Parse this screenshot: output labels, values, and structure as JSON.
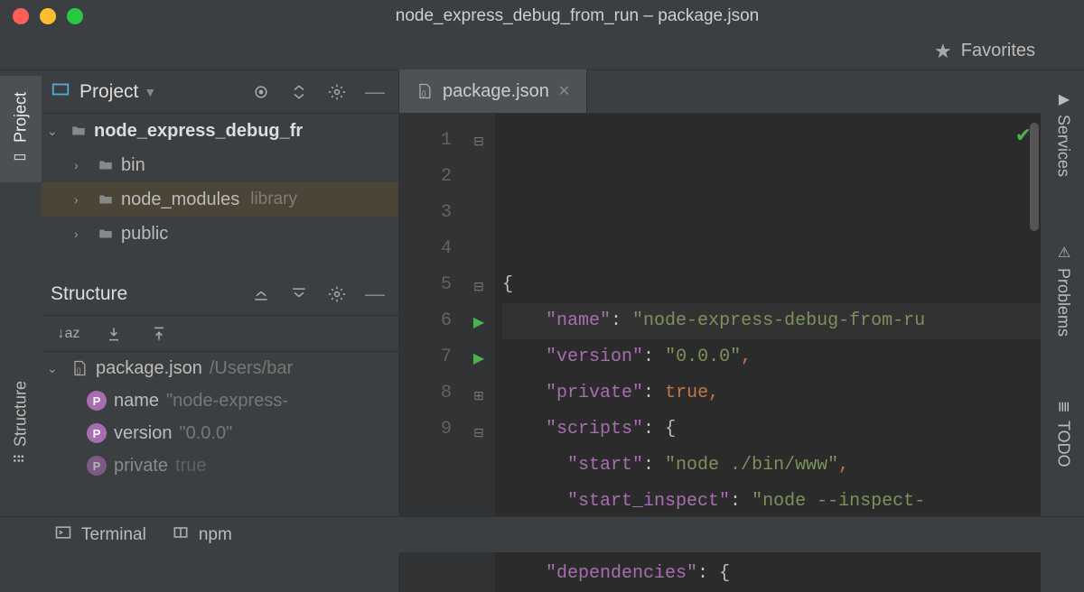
{
  "window": {
    "title": "node_express_debug_from_run – package.json"
  },
  "topbar": {
    "favorites": "Favorites"
  },
  "leftTabs": {
    "project": "Project",
    "structure": "Structure"
  },
  "rightTabs": {
    "services": "Services",
    "problems": "Problems",
    "todo": "TODO"
  },
  "projectPanel": {
    "title": "Project",
    "tree": {
      "root": "node_express_debug_fr",
      "items": [
        {
          "name": "bin",
          "type": "folder"
        },
        {
          "name": "node_modules",
          "type": "folder",
          "badge": "library",
          "selected": true
        },
        {
          "name": "public",
          "type": "folder"
        }
      ]
    }
  },
  "structurePanel": {
    "title": "Structure",
    "root": {
      "file": "package.json",
      "path": "/Users/bar"
    },
    "props": [
      {
        "key": "name",
        "value": "\"node-express-"
      },
      {
        "key": "version",
        "value": "\"0.0.0\""
      },
      {
        "key": "private",
        "value": "true"
      }
    ]
  },
  "editor": {
    "tab": {
      "filename": "package.json"
    },
    "lines": [
      {
        "n": 1,
        "fold": "open",
        "html": "{"
      },
      {
        "n": 2,
        "html": "    \"name\": \"node-express-debug-from-ru",
        "hl": true,
        "key": "name"
      },
      {
        "n": 3,
        "html": "    \"version\": \"0.0.0\",",
        "key": "version"
      },
      {
        "n": 4,
        "html": "    \"private\": true,",
        "key": "private"
      },
      {
        "n": 5,
        "fold": "open",
        "html": "    \"scripts\": {",
        "key": "scripts"
      },
      {
        "n": 6,
        "run": true,
        "html": "      \"start\": \"node ./bin/www\",",
        "key": "start"
      },
      {
        "n": 7,
        "run": true,
        "html": "      \"start_inspect\": \"node --inspect-",
        "key": "start_inspect"
      },
      {
        "n": 8,
        "fold": "close",
        "html": "    },"
      },
      {
        "n": 9,
        "fold": "open",
        "html": "    \"dependencies\": {",
        "key": "dependencies"
      }
    ],
    "code_tokens": [
      [
        {
          "t": "{",
          "c": "pun"
        }
      ],
      [
        {
          "t": "    ",
          "c": ""
        },
        {
          "t": "\"name\"",
          "c": "vkey"
        },
        {
          "t": ": ",
          "c": "pun"
        },
        {
          "t": "\"node-express-debug-from-ru",
          "c": "vstr"
        }
      ],
      [
        {
          "t": "    ",
          "c": ""
        },
        {
          "t": "\"version\"",
          "c": "vkey"
        },
        {
          "t": ": ",
          "c": "pun"
        },
        {
          "t": "\"0.0.0\"",
          "c": "vstr"
        },
        {
          "t": ",",
          "c": "k"
        }
      ],
      [
        {
          "t": "    ",
          "c": ""
        },
        {
          "t": "\"private\"",
          "c": "vkey"
        },
        {
          "t": ": ",
          "c": "pun"
        },
        {
          "t": "true",
          "c": "tru"
        },
        {
          "t": ",",
          "c": "k"
        }
      ],
      [
        {
          "t": "    ",
          "c": ""
        },
        {
          "t": "\"scripts\"",
          "c": "vkey"
        },
        {
          "t": ": ",
          "c": "pun"
        },
        {
          "t": "{",
          "c": "pun"
        }
      ],
      [
        {
          "t": "      ",
          "c": ""
        },
        {
          "t": "\"start\"",
          "c": "vkey"
        },
        {
          "t": ": ",
          "c": "pun"
        },
        {
          "t": "\"node ./bin/www\"",
          "c": "vstr"
        },
        {
          "t": ",",
          "c": "k"
        }
      ],
      [
        {
          "t": "      ",
          "c": ""
        },
        {
          "t": "\"start_inspect\"",
          "c": "vkey"
        },
        {
          "t": ": ",
          "c": "pun"
        },
        {
          "t": "\"node --inspect-",
          "c": "vstr"
        }
      ],
      [
        {
          "t": "    ",
          "c": ""
        },
        {
          "t": "}",
          "c": "pun"
        },
        {
          "t": ",",
          "c": "k"
        }
      ],
      [
        {
          "t": "    ",
          "c": ""
        },
        {
          "t": "\"dependencies\"",
          "c": "vkey"
        },
        {
          "t": ": ",
          "c": "pun"
        },
        {
          "t": "{",
          "c": "pun"
        }
      ]
    ]
  },
  "bottombar": {
    "terminal": "Terminal",
    "npm": "npm"
  }
}
